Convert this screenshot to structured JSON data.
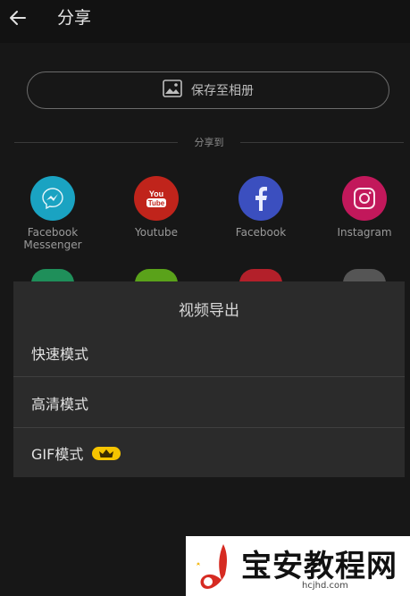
{
  "header": {
    "title": "分享"
  },
  "save": {
    "label": "保存至相册"
  },
  "share": {
    "section_label": "分享到",
    "targets": [
      {
        "name": "Facebook Messenger",
        "color": "#1aa3c2",
        "icon": "messenger-icon"
      },
      {
        "name": "Youtube",
        "color": "#c0241b",
        "icon": "youtube-icon"
      },
      {
        "name": "Facebook",
        "color": "#3b4fbf",
        "icon": "facebook-icon"
      },
      {
        "name": "Instagram",
        "color": "#c2185b",
        "icon": "instagram-icon"
      }
    ],
    "partial_row_colors": [
      "#1f8f5a",
      "#5aa21a",
      "#b3202a",
      "#555555"
    ]
  },
  "export_sheet": {
    "title": "视频导出",
    "options": [
      {
        "label": "快速模式"
      },
      {
        "label": "高清模式"
      },
      {
        "label": "GIF模式",
        "premium": true,
        "badge_icon": "crown-icon",
        "badge_color": "#f5c400"
      }
    ]
  },
  "watermark": {
    "text": "宝安教程网",
    "url": "hcjhd.com"
  }
}
